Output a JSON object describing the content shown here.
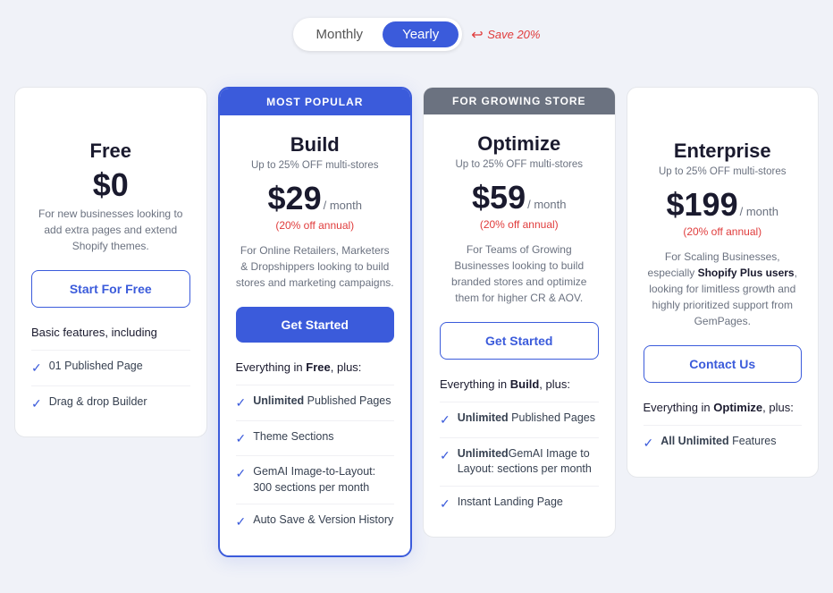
{
  "toggle": {
    "monthly_label": "Monthly",
    "yearly_label": "Yearly",
    "save_label": "Save 20%",
    "active": "yearly"
  },
  "plans": [
    {
      "id": "free",
      "badge": "",
      "badge_type": "empty",
      "name": "Free",
      "subtitle": "",
      "price": "$0",
      "period": "",
      "annual": "",
      "description": "For new businesses looking to add extra pages and extend Shopify themes.",
      "cta_label": "Start For Free",
      "cta_type": "outline",
      "features_intro": "Basic features, including",
      "features_intro_bold": "",
      "features": [
        {
          "text": "01 Published Page",
          "bold": ""
        },
        {
          "text": "Drag & drop Builder",
          "bold": ""
        }
      ]
    },
    {
      "id": "build",
      "badge": "MOST POPULAR",
      "badge_type": "blue",
      "name": "Build",
      "subtitle": "Up to 25% OFF multi-stores",
      "price": "$29",
      "period": "/ month",
      "annual": "(20% off annual)",
      "description": "For Online Retailers, Marketers & Dropshippers looking to build stores and marketing campaigns.",
      "cta_label": "Get Started",
      "cta_type": "solid",
      "features_intro": "Everything in ",
      "features_intro_bold": "Free",
      "features_intro_suffix": ", plus:",
      "features": [
        {
          "text": " Published Pages",
          "bold": "Unlimited"
        },
        {
          "text": "Theme Sections",
          "bold": ""
        },
        {
          "text": "GemAI Image-to-Layout: 300 sections per month",
          "bold": ""
        },
        {
          "text": "Auto Save & Version History",
          "bold": ""
        }
      ]
    },
    {
      "id": "optimize",
      "badge": "For Growing Store",
      "badge_type": "gray",
      "name": "Optimize",
      "subtitle": "Up to 25% OFF multi-stores",
      "price": "$59",
      "period": "/ month",
      "annual": "(20% off annual)",
      "description": "For Teams of Growing Businesses looking to build branded stores and optimize them for higher CR & AOV.",
      "cta_label": "Get Started",
      "cta_type": "outline",
      "features_intro": "Everything in ",
      "features_intro_bold": "Build",
      "features_intro_suffix": ", plus:",
      "features": [
        {
          "text": " Published Pages",
          "bold": "Unlimited"
        },
        {
          "text": "GemAI Image to Layout: ",
          "bold": "Unlimited",
          "suffix": " sections per month"
        },
        {
          "text": "Instant Landing Page",
          "bold": ""
        }
      ]
    },
    {
      "id": "enterprise",
      "badge": "",
      "badge_type": "empty",
      "name": "Enterprise",
      "subtitle": "Up to 25% OFF multi-stores",
      "price": "$199",
      "period": "/ month",
      "annual": "(20% off annual)",
      "description": "For Scaling Businesses, especially Shopify Plus users, looking for limitless growth and highly prioritized support from GemPages.",
      "description_bold": "Shopify Plus users",
      "cta_label": "Contact Us",
      "cta_type": "outline",
      "features_intro": "Everything in ",
      "features_intro_bold": "Optimize",
      "features_intro_suffix": ", plus:",
      "features": [
        {
          "text": " Features",
          "bold": "All Unlimited"
        }
      ]
    }
  ]
}
